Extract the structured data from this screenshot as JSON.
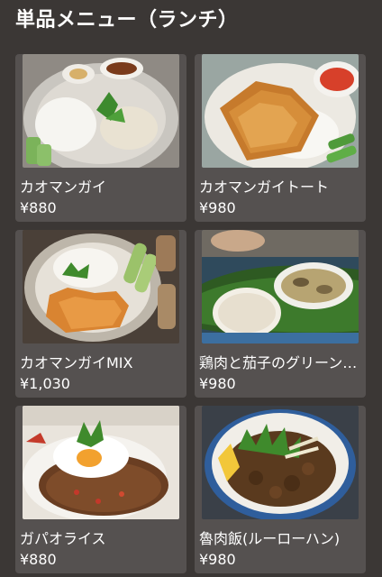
{
  "page": {
    "title": "単品メニュー（ランチ）"
  },
  "menu": {
    "items": [
      {
        "name": "カオマンガイ",
        "price": "¥880",
        "photo": "khao-man-gai-photo"
      },
      {
        "name": "カオマンガイトート",
        "price": "¥980",
        "photo": "khao-man-gai-tod-photo"
      },
      {
        "name": "カオマンガイMIX",
        "price": "¥1,030",
        "photo": "khao-man-gai-mix-photo"
      },
      {
        "name": "鶏肉と茄子のグリーンカレー",
        "price": "¥980",
        "photo": "green-curry-photo"
      },
      {
        "name": "ガパオライス",
        "price": "¥880",
        "photo": "gapao-rice-photo"
      },
      {
        "name": "魯肉飯(ルーローハン)",
        "price": "¥980",
        "photo": "lu-rou-fan-photo"
      }
    ]
  },
  "colors": {
    "background": "#3b3735",
    "card": "#555150",
    "text": "#ffffff"
  }
}
